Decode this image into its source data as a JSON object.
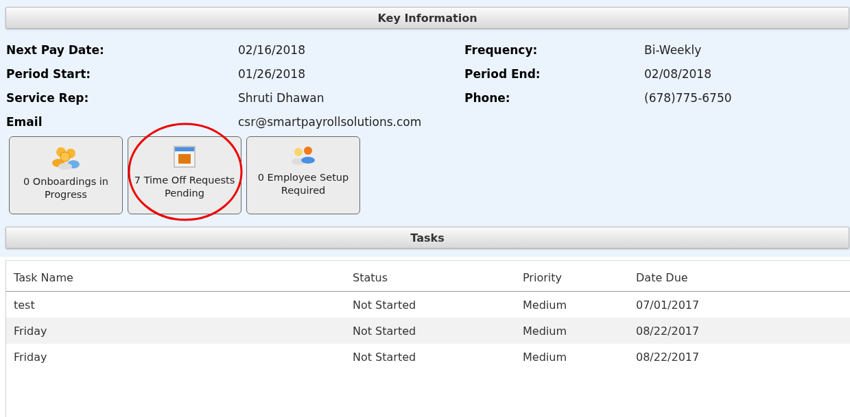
{
  "key_information": {
    "title": "Key Information",
    "fields": [
      {
        "label": "Next Pay Date:",
        "value": "02/16/2018"
      },
      {
        "label": "Frequency:",
        "value": "Bi-Weekly"
      },
      {
        "label": "Period Start:",
        "value": "01/26/2018"
      },
      {
        "label": "Period End:",
        "value": "02/08/2018"
      },
      {
        "label": "Service Rep:",
        "value": "Shruti Dhawan"
      },
      {
        "label": "Phone:",
        "value": "(678)775-6750"
      },
      {
        "label": "Email",
        "value": "csr@smartpayrollsolutions.com"
      }
    ],
    "buttons": [
      {
        "kind": "onboarding",
        "label": "0 Onboardings in Progress",
        "circled": false
      },
      {
        "kind": "timeoff",
        "label": "7 Time Off Requests Pending",
        "circled": true
      },
      {
        "kind": "setup",
        "label": "0 Employee Setup Required",
        "circled": false
      }
    ]
  },
  "tasks": {
    "title": "Tasks",
    "columns": [
      "Task Name",
      "Status",
      "Priority",
      "Date Due"
    ],
    "rows": [
      [
        "test",
        "Not Started",
        "Medium",
        "07/01/2017"
      ],
      [
        "Friday",
        "Not Started",
        "Medium",
        "08/22/2017"
      ],
      [
        "Friday",
        "Not Started",
        "Medium",
        "08/22/2017"
      ]
    ]
  }
}
